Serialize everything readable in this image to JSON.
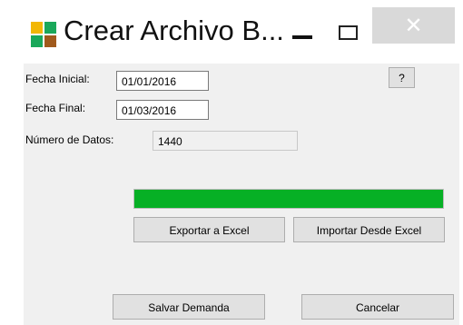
{
  "window": {
    "title": "Crear Archivo B...",
    "icon": "app-grid-icon",
    "minimize_icon": "minimize-icon",
    "maximize_icon": "maximize-icon",
    "close_icon": "close-icon",
    "close_glyph": "✕"
  },
  "form": {
    "fecha_inicial_label": "Fecha Inicial:",
    "fecha_inicial_value": "01/01/2016",
    "fecha_final_label": "Fecha Final:",
    "fecha_final_value": "01/03/2016",
    "numero_datos_label": "Número de Datos:",
    "numero_datos_value": "1440",
    "help_label": "?"
  },
  "progress": {
    "value_percent": 100,
    "color": "#06b025"
  },
  "buttons": {
    "exportar_label": "Exportar a Excel",
    "importar_label": "Importar Desde Excel",
    "salvar_label": "Salvar Demanda",
    "cancelar_label": "Cancelar"
  },
  "colors": {
    "client_background": "#f0f0f0",
    "close_button_background": "#d9d9d9"
  }
}
